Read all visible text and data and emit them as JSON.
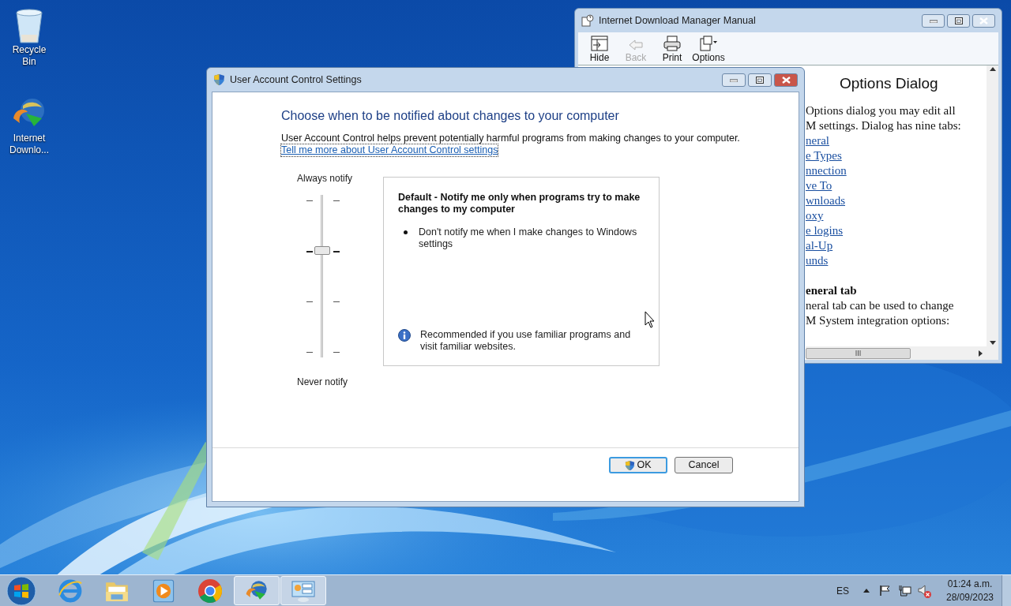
{
  "desktop": {
    "icons": [
      {
        "kind": "recycle",
        "label": "Recycle Bin"
      },
      {
        "kind": "idm",
        "label": "Internet Downlo..."
      }
    ]
  },
  "help_window": {
    "title": "Internet Download Manager Manual",
    "toolbar": [
      {
        "kind": "hide",
        "label": "Hide",
        "disabled": false
      },
      {
        "kind": "back",
        "label": "Back",
        "disabled": true
      },
      {
        "kind": "print",
        "label": "Print",
        "disabled": false
      },
      {
        "kind": "options",
        "label": "Options",
        "disabled": false
      }
    ],
    "heading": "Options Dialog",
    "lines": [
      {
        "kind": "text",
        "text": "Options dialog you may edit all"
      },
      {
        "kind": "text",
        "text": "M settings. Dialog has nine tabs:"
      },
      {
        "kind": "link",
        "text": "neral"
      },
      {
        "kind": "link",
        "text": "e Types"
      },
      {
        "kind": "link",
        "text": "nnection"
      },
      {
        "kind": "link",
        "text": "ve To"
      },
      {
        "kind": "link",
        "text": "wnloads"
      },
      {
        "kind": "link",
        "text": "oxy"
      },
      {
        "kind": "link",
        "text": "e logins"
      },
      {
        "kind": "link",
        "text": "al-Up"
      },
      {
        "kind": "link",
        "text": "unds"
      },
      {
        "kind": "bold",
        "text": "eneral tab"
      },
      {
        "kind": "text",
        "text": "neral tab can be used to change"
      },
      {
        "kind": "text",
        "text": "M System integration options:"
      }
    ]
  },
  "uac_window": {
    "title": "User Account Control Settings",
    "heading": "Choose when to be notified about changes to your computer",
    "description": "User Account Control helps prevent potentially harmful programs from making changes to your computer.",
    "link": "Tell me more about User Account Control settings",
    "slider": {
      "top_label": "Always notify",
      "bottom_label": "Never notify",
      "level": 0.67
    },
    "panel": {
      "title": "Default - Notify me only when programs try to make changes to my computer",
      "bullets": [
        "Don't notify me when I make changes to Windows settings"
      ],
      "note": "Recommended if you use familiar programs and visit familiar websites."
    },
    "buttons": [
      {
        "label": "OK",
        "default": true,
        "shield": true
      },
      {
        "label": "Cancel",
        "default": false,
        "shield": false
      }
    ]
  },
  "taskbar": {
    "apps": [
      {
        "kind": "ie",
        "active": false
      },
      {
        "kind": "explorer",
        "active": false
      },
      {
        "kind": "media",
        "active": false
      },
      {
        "kind": "chrome",
        "active": false
      },
      {
        "kind": "idm",
        "active": true
      },
      {
        "kind": "uac",
        "active": true
      }
    ],
    "tray": {
      "language": "ES",
      "muted": true,
      "time": "01:24 a.m.",
      "date": "28/09/2023"
    }
  }
}
